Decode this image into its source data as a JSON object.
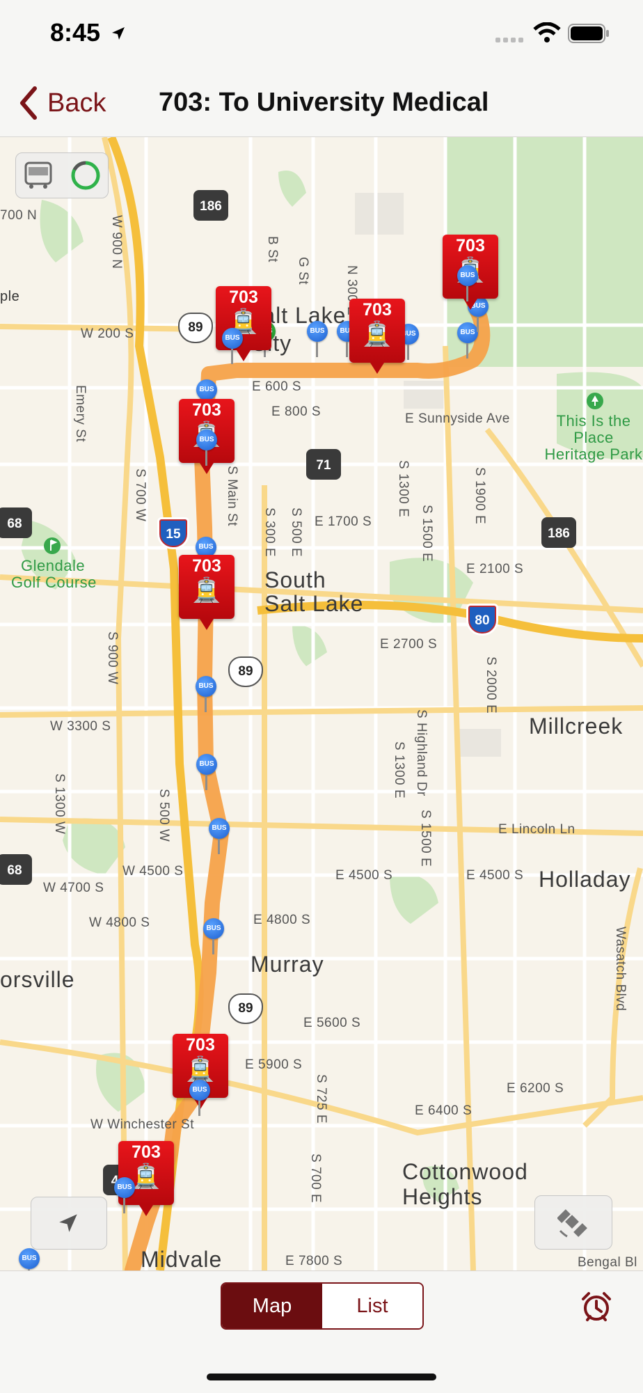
{
  "status_bar": {
    "time": "8:45"
  },
  "nav": {
    "back_label": "Back",
    "title": "703: To University Medical"
  },
  "map": {
    "places": {
      "salt_lake": "Salt Lake",
      "city": "City",
      "south_salt_lake_1": "South",
      "south_salt_lake_2": "Salt Lake",
      "millcreek": "Millcreek",
      "holladay": "Holladay",
      "murray": "Murray",
      "taylorsville": "orsville",
      "cottonwood_1": "Cottonwood",
      "cottonwood_2": "Heights",
      "midvale": "Midvale",
      "maple": "ple"
    },
    "parks": {
      "heritage_park": "This Is the Place Heritage Park",
      "glendale_1": "Glendale",
      "glendale_2": "Golf Course"
    },
    "streets": {
      "w200s": "W 200 S",
      "e600s": "E 600 S",
      "e800s": "E 800 S",
      "sunnyside": "E Sunnyside Ave",
      "e1700s": "E 1700 S",
      "e2100s": "E 2100 S",
      "e2700s": "E 2700 S",
      "w3300s": "W 3300 S",
      "lincoln": "E Lincoln Ln",
      "e4500s_a": "E 4500 S",
      "e4500s_b": "E 4500 S",
      "w4500s": "W 4500 S",
      "w4700s": "W 4700 S",
      "w4800s": "W 4800 S",
      "e4800s": "E 4800 S",
      "e5600s": "E 5600 S",
      "e5900s": "E 5900 S",
      "e6200s": "E 6200 S",
      "e6400s": "E 6400 S",
      "winchester": "W Winchester St",
      "e7800s": "E 7800 S",
      "bengal": "Bengal Bl",
      "n700": "700 N",
      "w900n": "W 900 N",
      "bst": "B St",
      "gst": "G St",
      "n300e": "N 300 E",
      "emery": "Emery St",
      "s700w": "S 700 W",
      "smain": "S Main St",
      "s300e": "S 300 E",
      "s500e": "S 500 E",
      "s1300e": "S 1300 E",
      "s1500e": "S 1500 E",
      "s1900e": "S 1900 E",
      "s900w": "S 900 W",
      "s2000e": "S 2000 E",
      "highland": "S Highland Dr",
      "s1300e_b": "S 1300 E",
      "s1500e_b": "S 1500 E",
      "s1300w": "S 1300 W",
      "s500w": "S 500 W",
      "s725e": "S 725 E",
      "s700e": "S 700 E",
      "wasatch": "Wasatch Blvd"
    },
    "shields": {
      "sr186_a": "186",
      "sr186_b": "186",
      "us89_a": "89",
      "us89_b": "89",
      "us89_c": "89",
      "sr71": "71",
      "i15": "15",
      "i80": "80",
      "sr68_a": "68",
      "sr68_b": "68",
      "sr_partial": "4"
    },
    "route_color": "#f6a24a",
    "train_color": "#d80e14",
    "trains": [
      {
        "route": "703"
      },
      {
        "route": "703"
      },
      {
        "route": "703"
      },
      {
        "route": "703"
      },
      {
        "route": "703"
      },
      {
        "route": "703"
      },
      {
        "route": "703"
      }
    ],
    "stop_label": "BUS"
  },
  "tabs": {
    "map_label": "Map",
    "list_label": "List",
    "selected": "Map"
  },
  "colors": {
    "accent": "#7a1418",
    "selected_segment": "#6b0d10"
  }
}
